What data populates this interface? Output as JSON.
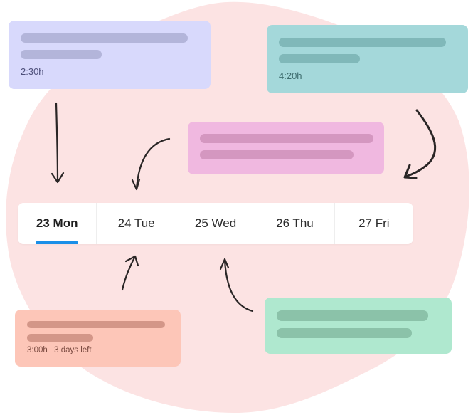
{
  "colors": {
    "blob": "#fce3e3",
    "accent": "#1a8fe8"
  },
  "cards": [
    {
      "id": "lavender",
      "bg": "#d8d9fc",
      "bar": "#b3b5da",
      "meta_color": "#4d4f7a",
      "meta": "2:30h"
    },
    {
      "id": "teal",
      "bg": "#a4d8da",
      "bar": "#80b8b9",
      "meta_color": "#3e6d6e",
      "meta": "4:20h"
    },
    {
      "id": "pink",
      "bg": "#f0b8e0",
      "bar": "#d497c0",
      "meta_color": "",
      "meta": ""
    },
    {
      "id": "salmon",
      "bg": "#fdc6b8",
      "bar": "#d39688",
      "meta_color": "#7a4a40",
      "meta": "3:00h | 3 days left"
    },
    {
      "id": "mint",
      "bg": "#afe8cf",
      "bar": "#8bc2a9",
      "meta_color": "",
      "meta": ""
    }
  ],
  "tabs": [
    {
      "label": "23 Mon",
      "active": true
    },
    {
      "label": "24 Tue",
      "active": false
    },
    {
      "label": "25 Wed",
      "active": false
    },
    {
      "label": "26 Thu",
      "active": false
    },
    {
      "label": "27 Fri",
      "active": false
    }
  ]
}
